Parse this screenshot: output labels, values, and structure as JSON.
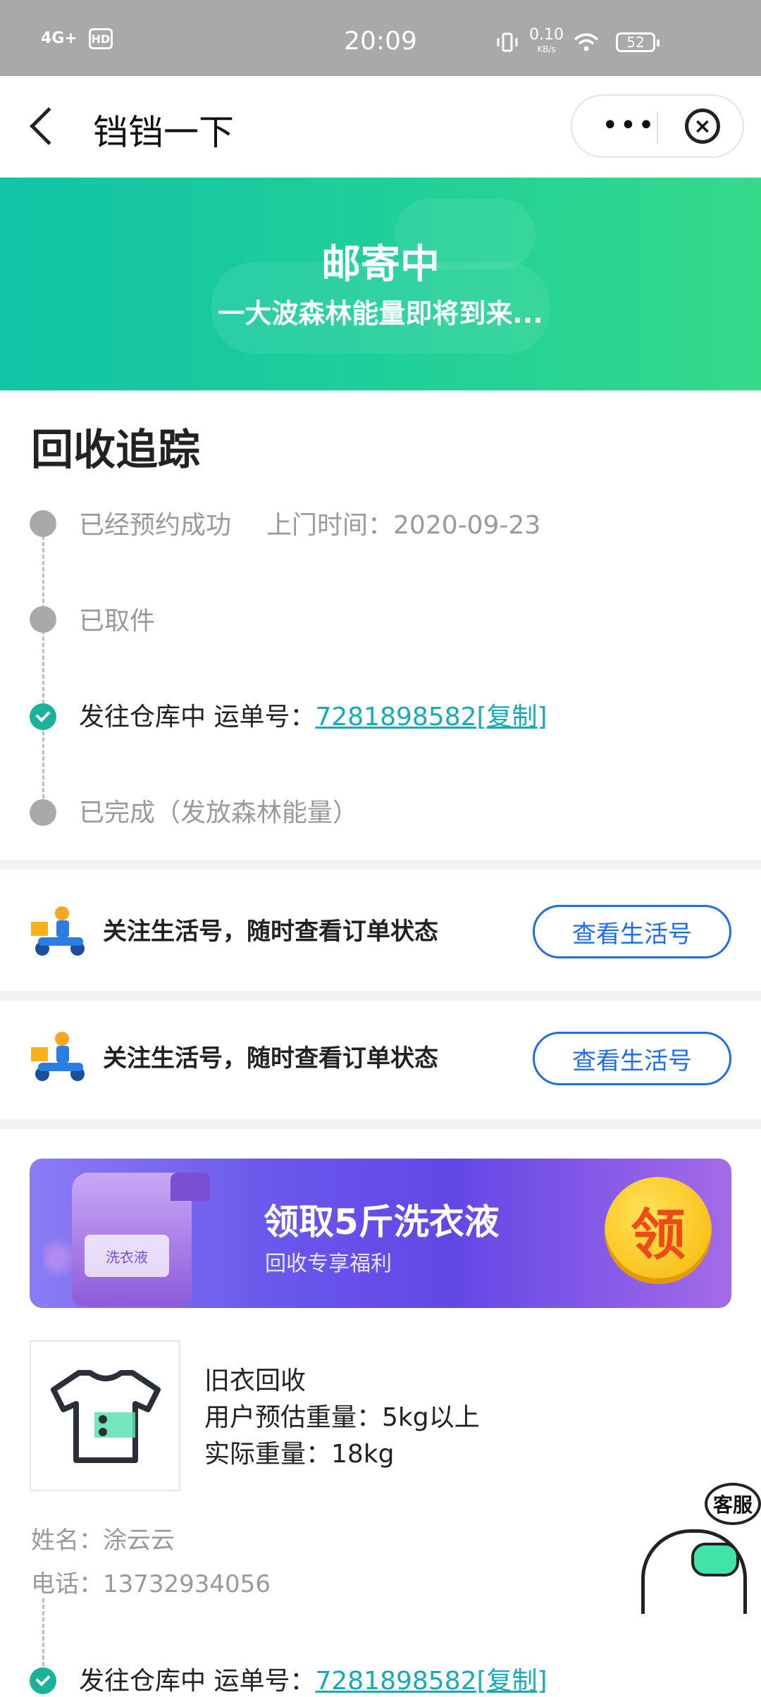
{
  "status_bar": {
    "network": "4G+",
    "hd": "HD",
    "time": "20:09",
    "speed_value": "0.10",
    "speed_unit": "KB/s",
    "battery": "52"
  },
  "nav": {
    "title": "铛铛一下",
    "more_icon": "more-dots-icon",
    "close_icon": "close-circle-icon"
  },
  "banner": {
    "status": "邮寄中",
    "subtitle": "一大波森林能量即将到来..."
  },
  "tracking": {
    "title": "回收追踪",
    "steps": [
      {
        "label": "已经预约成功",
        "extra": "上门时间：2020-09-23"
      },
      {
        "label": "已取件"
      },
      {
        "label": "发往仓库中 运单号：",
        "waybill": "7281898582[复制]"
      },
      {
        "label": "已完成（发放森林能量）"
      }
    ]
  },
  "follow": [
    {
      "text": "关注生活号，随时查看订单状态",
      "button": "查看生活号"
    },
    {
      "text": "关注生活号，随时查看订单状态",
      "button": "查看生活号"
    }
  ],
  "promo": {
    "title": "领取5斤洗衣液",
    "subtitle": "回收专享福利",
    "coin_label": "领",
    "bottle_label": "洗衣液"
  },
  "product": {
    "name": "旧衣回收",
    "estimated_weight": "用户预估重量：5kg以上",
    "actual_weight": "实际重量：18kg"
  },
  "contact": {
    "name": "姓名：涂云云",
    "phone": "电话：13732934056"
  },
  "overlay_step": {
    "label": "发往仓库中 运单号：",
    "waybill": "7281898582[复制]"
  },
  "customer_service": {
    "label": "客服"
  },
  "colors": {
    "banner_start": "#12c3a6",
    "banner_end": "#34d98a",
    "link": "#17aab2",
    "button_blue": "#1e6ee8",
    "promo_purple": "#6247e6"
  }
}
